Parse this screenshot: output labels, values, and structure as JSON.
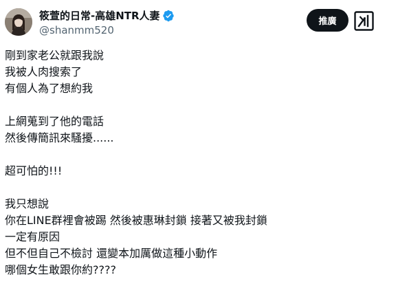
{
  "author": {
    "display_name": "筱萱的日常-高雄NTR人妻",
    "handle": "@shanmm520",
    "verified": true,
    "avatar_icon": "avatar-photo"
  },
  "actions": {
    "promote_label": "推廣",
    "grok_icon": "grok-icon"
  },
  "colors": {
    "text": "#0f1419",
    "secondary": "#536471",
    "verified_badge": "#1d9bf0",
    "button_bg": "#0f1419"
  },
  "post": {
    "paragraphs": [
      [
        "剛到家老公就跟我說",
        "我被人肉搜索了",
        "有個人為了想約我"
      ],
      [
        "上網蒐到了他的電話",
        "然後傳簡訊來騷擾......"
      ],
      [
        "超可怕的!!!"
      ],
      [
        "我只想說",
        "你在LINE群裡會被踢 然後被惠琳封鎖 接著又被我封鎖",
        "一定有原因",
        "但不但自己不檢討 還變本加厲做這種小動作",
        "哪個女生敢跟你約????"
      ]
    ]
  }
}
